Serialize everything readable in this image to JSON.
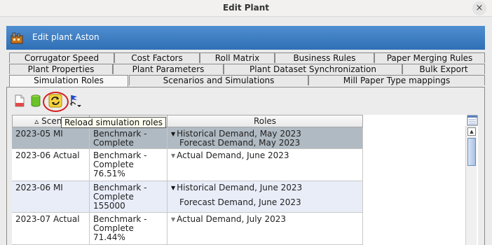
{
  "window": {
    "title": "Edit Plant",
    "close_glyph": "×"
  },
  "header": {
    "text": "Edit plant Aston",
    "icon": "plant-building-icon"
  },
  "tabs": {
    "row1": [
      "Corrugator Speed",
      "Cost Factors",
      "Roll Matrix",
      "Business Rules",
      "Paper Merging Rules"
    ],
    "row2": [
      "Plant Properties",
      "Plant Parameters",
      "Plant Dataset Synchronization",
      "Bulk Export"
    ],
    "row3": [
      "Simulation Roles",
      "Scenarios and Simulations",
      "Mill Paper Type mappings"
    ],
    "active": "Simulation Roles"
  },
  "toolbar": {
    "buttons": [
      "new-document-icon",
      "database-icon",
      "reload-icon",
      "flag-dropdown-icon"
    ],
    "tooltip": "Reload simulation roles"
  },
  "table": {
    "headers": {
      "scenario": "Scena",
      "sort_indicator": "▵",
      "roles": "Roles"
    },
    "rows": [
      {
        "scenario": "2023-05 MI",
        "status": [
          "Benchmark -",
          "Complete"
        ],
        "roles": [
          "Historical Demand, May 2023",
          "Forecast Demand, May 2023"
        ],
        "expanded": true
      },
      {
        "scenario": "2023-06 Actual",
        "status": [
          "Benchmark -",
          "Complete",
          "76.51%"
        ],
        "roles": [
          "Actual Demand, June 2023"
        ],
        "expanded": false
      },
      {
        "scenario": "2023-06 MI",
        "status": [
          "Benchmark -",
          "Complete",
          "155000"
        ],
        "roles": [
          "Historical Demand, June 2023",
          "Forecast Demand, June 2023"
        ],
        "expanded": true
      },
      {
        "scenario": "2023-07 Actual",
        "status": [
          "Benchmark -",
          "Complete",
          "71.44%"
        ],
        "roles": [
          "Actual Demand, July 2023"
        ],
        "expanded": false
      }
    ]
  },
  "colors": {
    "header_blue": "#3a7cc2",
    "selected_row": "#b0bac2",
    "alt_row": "#e8edf8",
    "highlight_red": "#d42020"
  }
}
